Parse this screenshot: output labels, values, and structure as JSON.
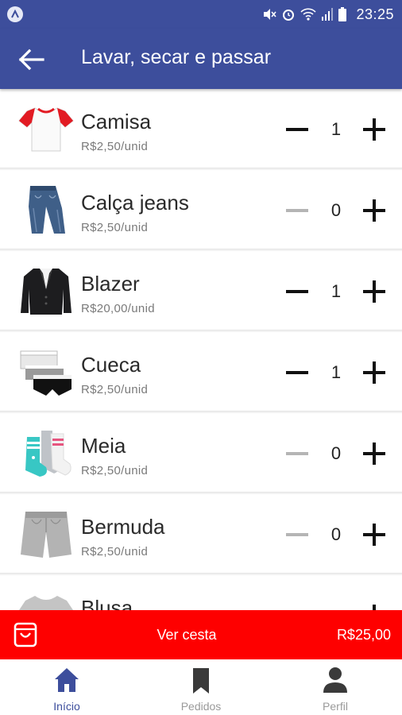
{
  "status_bar": {
    "time": "23:25",
    "icons": [
      "app-badge-icon",
      "mute-icon",
      "alarm-icon",
      "wifi-icon",
      "signal-icon",
      "battery-icon"
    ]
  },
  "app_bar": {
    "back_icon": "arrow-left-icon",
    "title": "Lavar, secar e passar"
  },
  "items": [
    {
      "name": "Camisa",
      "price": "R$2,50/unid",
      "qty": "1",
      "minus_enabled": true,
      "icon": "tshirt-image"
    },
    {
      "name": "Calça jeans",
      "price": "R$2,50/unid",
      "qty": "0",
      "minus_enabled": false,
      "icon": "jeans-image"
    },
    {
      "name": "Blazer",
      "price": "R$20,00/unid",
      "qty": "1",
      "minus_enabled": true,
      "icon": "blazer-image"
    },
    {
      "name": "Cueca",
      "price": "R$2,50/unid",
      "qty": "1",
      "minus_enabled": true,
      "icon": "underwear-image"
    },
    {
      "name": "Meia",
      "price": "R$2,50/unid",
      "qty": "0",
      "minus_enabled": false,
      "icon": "socks-image"
    },
    {
      "name": "Bermuda",
      "price": "R$2,50/unid",
      "qty": "0",
      "minus_enabled": false,
      "icon": "shorts-image"
    },
    {
      "name": "Blusa",
      "price": "",
      "qty": "",
      "minus_enabled": false,
      "icon": "blouse-image"
    }
  ],
  "basket": {
    "icon": "shopping-bag-icon",
    "label": "Ver cesta",
    "total": "R$25,00"
  },
  "bottom_nav": [
    {
      "label": "Início",
      "icon": "home-icon",
      "active": true
    },
    {
      "label": "Pedidos",
      "icon": "bookmark-icon",
      "active": false
    },
    {
      "label": "Perfil",
      "icon": "person-icon",
      "active": false
    }
  ],
  "colors": {
    "primary": "#3d4e9c",
    "basket_red": "#fe0000",
    "minus_active": "#111111",
    "minus_disabled": "#b5b5b5"
  }
}
